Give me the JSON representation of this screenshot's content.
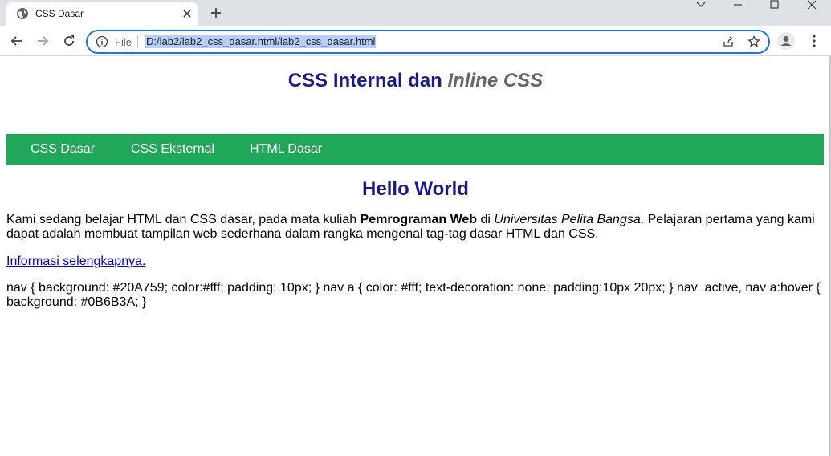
{
  "browser": {
    "tab": {
      "title": "CSS Dasar",
      "favicon": "globe-icon"
    },
    "window_controls": [
      "minimize-icon",
      "maximize-icon",
      "close-icon"
    ],
    "omnibox": {
      "scheme_label": "File",
      "url": "D:/lab2/lab2_css_dasar.html/lab2_css_dasar.html",
      "url_selected": true
    },
    "icons": [
      "back-arrow-icon",
      "forward-arrow-icon",
      "reload-icon",
      "share-icon",
      "star-icon",
      "profile-icon",
      "more-menu-icon"
    ]
  },
  "page": {
    "title_main": "CSS Internal dan ",
    "title_inline": "Inline CSS",
    "nav": {
      "items": [
        {
          "label": "CSS Dasar"
        },
        {
          "label": "CSS Eksternal"
        },
        {
          "label": "HTML Dasar"
        }
      ],
      "background": "#20A759",
      "text_color": "#ffffff"
    },
    "heading": "Hello World",
    "paragraph": {
      "part1": "Kami sedang belajar HTML dan CSS dasar, pada mata kuliah ",
      "bold": "Pemrograman Web",
      "part2": " di ",
      "italic": "Universitas Pelita Bangsa",
      "part3": ". Pelajaran pertama yang kami dapat adalah membuat tampilan web sederhana dalam rangka mengenal tag-tag dasar HTML dan CSS."
    },
    "more_link": "Informasi selengkapnya.",
    "css_text": "nav { background: #20A759; color:#fff; padding: 10px; } nav a { color: #fff; text-decoration: none; padding:10px 20px; } nav .active, nav a:hover { background: #0B6B3A; }",
    "colors": {
      "heading": "#1a1a8c",
      "inline_title": "#666666",
      "link": "#0000ee"
    }
  }
}
